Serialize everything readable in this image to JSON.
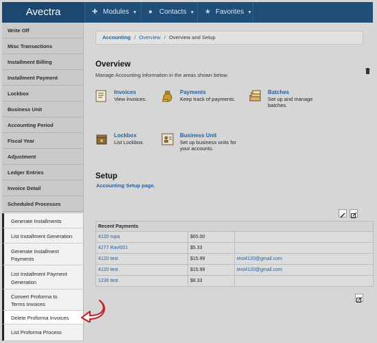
{
  "app": {
    "title": "Avectra"
  },
  "topnav": [
    {
      "label": "Modules",
      "icon": "puzzle-icon"
    },
    {
      "label": "Contacts",
      "icon": "person-icon"
    },
    {
      "label": "Favorites",
      "icon": "star-icon"
    }
  ],
  "sidebar": {
    "items": [
      {
        "label": "Write Off"
      },
      {
        "label": "Misc Transactions"
      },
      {
        "label": "Installment Billing"
      },
      {
        "label": "Installment Payment"
      },
      {
        "label": "Lockbox"
      },
      {
        "label": "Business Unit"
      },
      {
        "label": "Accounting Period"
      },
      {
        "label": "Fiscal Year"
      },
      {
        "label": "Adjustment"
      },
      {
        "label": "Ledger Entries"
      },
      {
        "label": "Invoice Detail"
      },
      {
        "label": "Scheduled Processes"
      }
    ],
    "subitems": [
      {
        "line1": "Generate Installments",
        "line2": ""
      },
      {
        "line1": "List Installment Generation",
        "line2": ""
      },
      {
        "line1": "Generate Installment",
        "line2": "Payments"
      },
      {
        "line1": "List Installment Payment",
        "line2": "Generation"
      },
      {
        "line1": "Convert Proforma to",
        "line2": "Terms Invoices"
      },
      {
        "line1": "Delete Proforma Invoices",
        "line2": ""
      },
      {
        "line1": "List Proforma Process",
        "line2": ""
      }
    ]
  },
  "breadcrumb": {
    "part1": "Accounting",
    "sep1": "/",
    "part2": "Overview",
    "sep2": "/",
    "part3": "Overview and Setup"
  },
  "overview": {
    "title": "Overview",
    "description": "Manage Accounting information in the areas shown below.",
    "tiles": [
      {
        "title": "Invoices",
        "desc1": "View invoices.",
        "desc2": ""
      },
      {
        "title": "Payments",
        "desc1": "Keep track of payments.",
        "desc2": ""
      },
      {
        "title": "Batches",
        "desc1": "Set up and manage",
        "desc2": "batches."
      },
      {
        "title": "Lockbox",
        "desc1": "List Lockbox.",
        "desc2": ""
      },
      {
        "title": "Business Unit",
        "desc1": "Set up business units for",
        "desc2": "your accounts."
      }
    ]
  },
  "setup": {
    "title": "Setup",
    "link": "Accounting Setup page."
  },
  "recent_payments": {
    "header": "Recent Payments",
    "rows": [
      {
        "name": "4120 rupa",
        "amount": "$65.00",
        "email": ""
      },
      {
        "name": "4277 Ravi001",
        "amount": "$5.33",
        "email": ""
      },
      {
        "name": "4120 test",
        "amount": "$15.99",
        "email": "test4120@gmail.com"
      },
      {
        "name": "4120 test",
        "amount": "$15.99",
        "email": "test4120@gmail.com"
      },
      {
        "name": "1236 test",
        "amount": "$8.33",
        "email": ""
      }
    ]
  },
  "colors": {
    "topbar": "#1f4e79",
    "link": "#1f5fa5",
    "callout": "#c0282d"
  }
}
